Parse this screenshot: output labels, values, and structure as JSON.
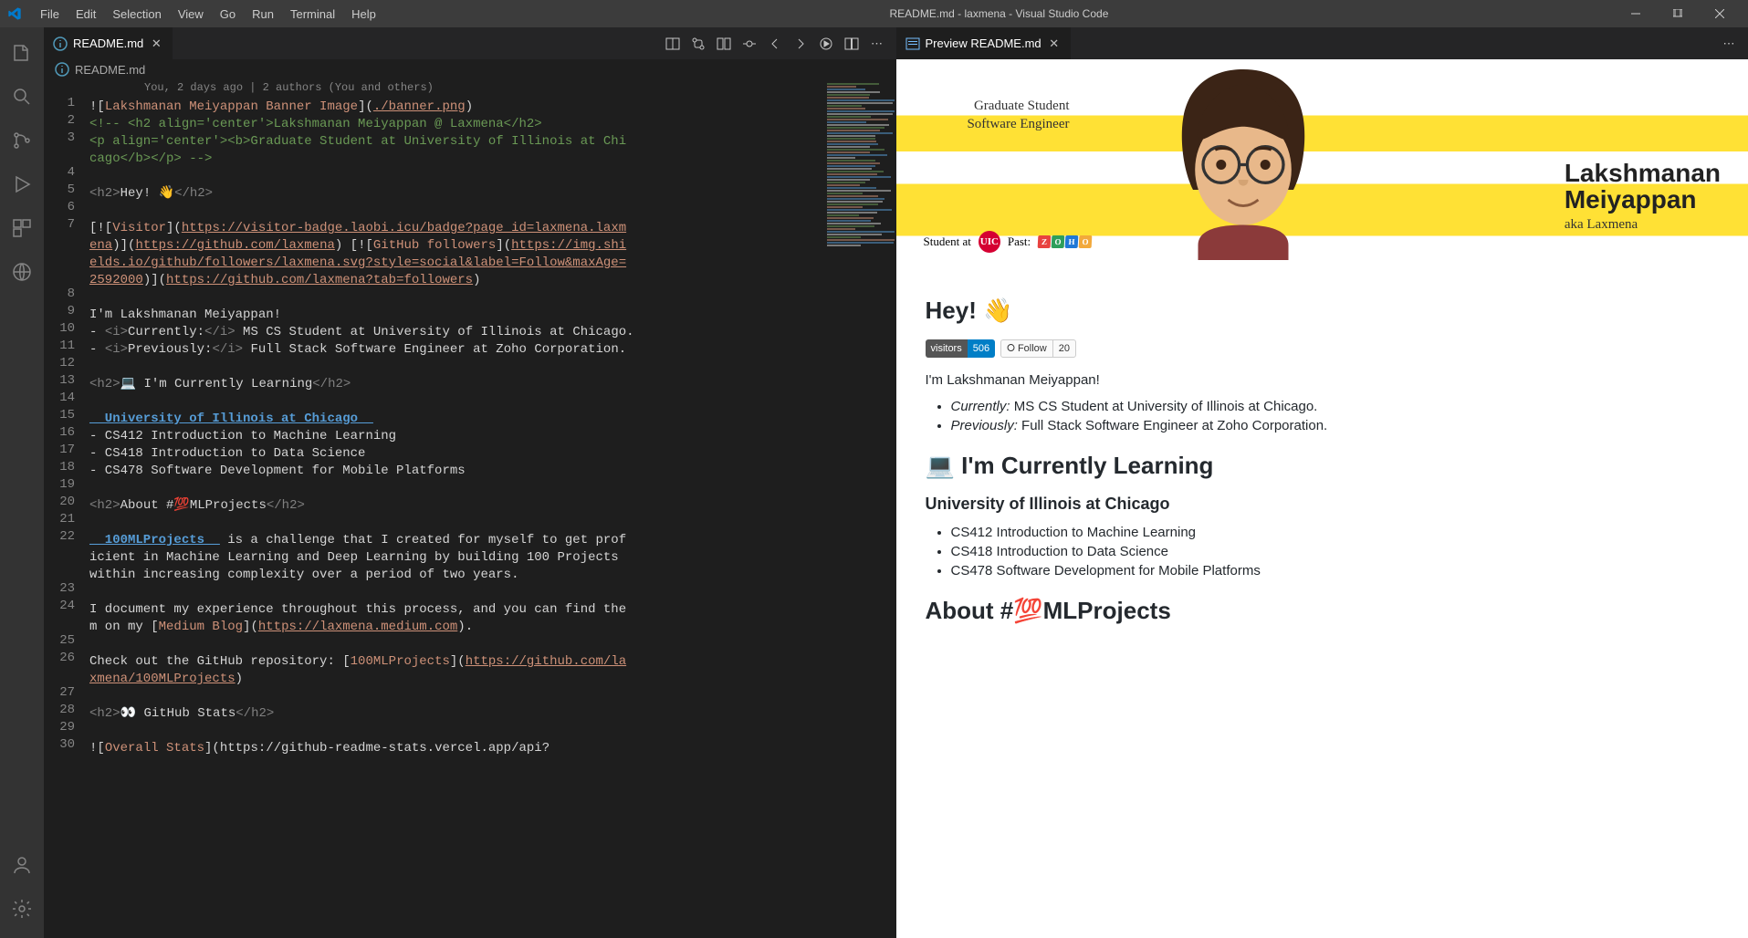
{
  "titlebar": {
    "title": "README.md - laxmena - Visual Studio Code",
    "menu": [
      "File",
      "Edit",
      "Selection",
      "View",
      "Go",
      "Run",
      "Terminal",
      "Help"
    ]
  },
  "editor": {
    "tab_label": "README.md",
    "breadcrumb": "README.md",
    "blame": "You, 2 days ago | 2 authors (You and others)",
    "lines": [
      {
        "n": 1,
        "seg": [
          [
            "c-bracket",
            "!["
          ],
          [
            "c-string",
            "Lakshmanan Meiyappan Banner Image"
          ],
          [
            "c-bracket",
            "]("
          ],
          [
            "c-link",
            "./banner.png"
          ],
          [
            "c-bracket",
            ")"
          ]
        ]
      },
      {
        "n": 2,
        "seg": [
          [
            "c-comment",
            "<!-- <h2 align='center'>Lakshmanan Meiyappan @ Laxmena</h2>"
          ]
        ]
      },
      {
        "n": 3,
        "seg": [
          [
            "c-comment",
            "<p align='center'><b>Graduate Student at University of Illinois at Chicago</b></p> -->"
          ]
        ],
        "wrap": true
      },
      {
        "n": 4,
        "seg": [
          [
            "",
            ""
          ]
        ]
      },
      {
        "n": 5,
        "seg": [
          [
            "c-tag",
            "<h2>"
          ],
          [
            "c-text",
            "Hey! 👋"
          ],
          [
            "c-tag",
            "</h2>"
          ]
        ]
      },
      {
        "n": 6,
        "seg": [
          [
            "",
            ""
          ]
        ]
      },
      {
        "n": 7,
        "seg": [
          [
            "c-bracket",
            "[!["
          ],
          [
            "c-string",
            "Visitor"
          ],
          [
            "c-bracket",
            "]("
          ],
          [
            "c-link",
            "https://visitor-badge.laobi.icu/badge?page_id=laxmena.laxmena"
          ],
          [
            "c-bracket",
            ")]("
          ],
          [
            "c-link",
            "https://github.com/laxmena"
          ],
          [
            "c-bracket",
            ") [!["
          ],
          [
            "c-string",
            "GitHub followers"
          ],
          [
            "c-bracket",
            "]("
          ],
          [
            "c-link",
            "https://img.shields.io/github/followers/laxmena.svg?style=social&label=Follow&maxAge=2592000"
          ],
          [
            "c-bracket",
            ")]("
          ],
          [
            "c-link",
            "https://github.com/laxmena?tab=followers"
          ],
          [
            "c-bracket",
            ")"
          ]
        ],
        "wrap": true
      },
      {
        "n": 8,
        "seg": [
          [
            "",
            ""
          ]
        ]
      },
      {
        "n": 9,
        "seg": [
          [
            "c-text",
            "I'm Lakshmanan Meiyappan!"
          ]
        ]
      },
      {
        "n": 10,
        "seg": [
          [
            "c-text",
            "- "
          ],
          [
            "c-tag",
            "<i>"
          ],
          [
            "c-text",
            "Currently:"
          ],
          [
            "c-tag",
            "</i>"
          ],
          [
            "c-text",
            " MS CS Student at University of Illinois at Chicago."
          ]
        ]
      },
      {
        "n": 11,
        "seg": [
          [
            "c-text",
            "- "
          ],
          [
            "c-tag",
            "<i>"
          ],
          [
            "c-text",
            "Previously:"
          ],
          [
            "c-tag",
            "</i>"
          ],
          [
            "c-text",
            " Full Stack Software Engineer at Zoho Corporation."
          ]
        ]
      },
      {
        "n": 12,
        "seg": [
          [
            "",
            ""
          ]
        ]
      },
      {
        "n": 13,
        "seg": [
          [
            "c-tag",
            "<h2>"
          ],
          [
            "c-text",
            "💻 I'm Currently Learning"
          ],
          [
            "c-tag",
            "</h2>"
          ]
        ]
      },
      {
        "n": 14,
        "seg": [
          [
            "",
            ""
          ]
        ]
      },
      {
        "n": 15,
        "seg": [
          [
            "c-bold",
            "__University of Illinois at Chicago__"
          ]
        ]
      },
      {
        "n": 16,
        "seg": [
          [
            "c-text",
            "- CS412 Introduction to Machine Learning"
          ]
        ]
      },
      {
        "n": 17,
        "seg": [
          [
            "c-text",
            "- CS418 Introduction to Data Science"
          ]
        ]
      },
      {
        "n": 18,
        "seg": [
          [
            "c-text",
            "- CS478 Software Development for Mobile Platforms"
          ]
        ]
      },
      {
        "n": 19,
        "seg": [
          [
            "",
            ""
          ]
        ]
      },
      {
        "n": 20,
        "seg": [
          [
            "c-tag",
            "<h2>"
          ],
          [
            "c-text",
            "About #💯MLProjects"
          ],
          [
            "c-tag",
            "</h2>"
          ]
        ]
      },
      {
        "n": 21,
        "seg": [
          [
            "",
            ""
          ]
        ]
      },
      {
        "n": 22,
        "seg": [
          [
            "c-bold",
            "__100MLProjects__"
          ],
          [
            "c-text",
            " is a challenge that I created for myself to get proficient in Machine Learning and Deep Learning by building 100 Projects within increasing complexity over a period of two years."
          ]
        ],
        "wrap": true
      },
      {
        "n": 23,
        "seg": [
          [
            "",
            ""
          ]
        ]
      },
      {
        "n": 24,
        "seg": [
          [
            "c-text",
            "I document my experience throughout this process, and you can find them on my ["
          ],
          [
            "c-string",
            "Medium Blog"
          ],
          [
            "c-bracket",
            "]("
          ],
          [
            "c-link",
            "https://laxmena.medium.com"
          ],
          [
            "c-bracket",
            ")."
          ]
        ],
        "wrap": true
      },
      {
        "n": 25,
        "seg": [
          [
            "",
            ""
          ]
        ]
      },
      {
        "n": 26,
        "seg": [
          [
            "c-text",
            "Check out the GitHub repository: ["
          ],
          [
            "c-string",
            "100MLProjects"
          ],
          [
            "c-bracket",
            "]("
          ],
          [
            "c-link",
            "https://github.com/laxmena/100MLProjects"
          ],
          [
            "c-bracket",
            ")"
          ]
        ],
        "wrap": true
      },
      {
        "n": 27,
        "seg": [
          [
            "",
            ""
          ]
        ]
      },
      {
        "n": 28,
        "seg": [
          [
            "c-tag",
            "<h2>"
          ],
          [
            "c-text",
            "👀 GitHub Stats"
          ],
          [
            "c-tag",
            "</h2>"
          ]
        ]
      },
      {
        "n": 29,
        "seg": [
          [
            "",
            ""
          ]
        ]
      },
      {
        "n": 30,
        "seg": [
          [
            "c-bracket",
            "!["
          ],
          [
            "c-string",
            "Overall Stats"
          ],
          [
            "c-bracket",
            "](https://github-readme-stats.vercel.app/api?"
          ]
        ]
      }
    ]
  },
  "preview": {
    "tab_label": "Preview README.md",
    "banner": {
      "line1": "Graduate Student",
      "line2": "Software Engineer",
      "name1": "Lakshmanan",
      "name2": "Meiyappan",
      "aka": "aka Laxmena",
      "student_at": "Student at",
      "uic": "UIC",
      "past": "Past:",
      "zoho": "ZOHO"
    },
    "badges": {
      "visitors_label": "visitors",
      "visitors_count": "506",
      "follow_label": "Follow",
      "follow_count": "20"
    },
    "hey": "Hey! 👋",
    "intro": "I'm Lakshmanan Meiyappan!",
    "currently_label": "Currently:",
    "currently_text": " MS CS Student at University of Illinois at Chicago.",
    "previously_label": "Previously:",
    "previously_text": " Full Stack Software Engineer at Zoho Corporation.",
    "learning_h2": "💻 I'm Currently Learning",
    "uic_h3": "University of Illinois at Chicago",
    "courses": [
      "CS412 Introduction to Machine Learning",
      "CS418 Introduction to Data Science",
      "CS478 Software Development for Mobile Platforms"
    ],
    "about_h2": "About #💯MLProjects"
  }
}
